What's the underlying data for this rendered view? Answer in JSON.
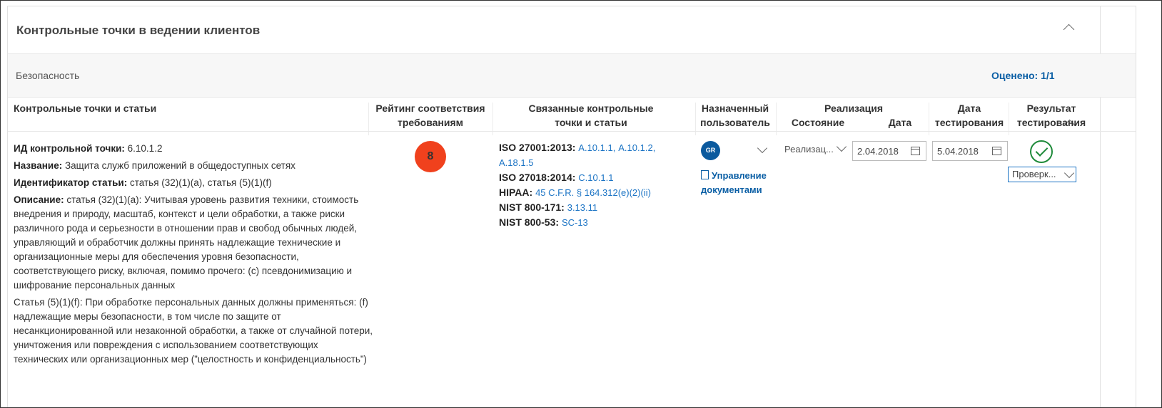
{
  "card": {
    "title": "Контрольные точки в ведении клиентов"
  },
  "section": {
    "label": "Безопасность",
    "assessed": "Оценено: 1/1"
  },
  "table": {
    "headers": {
      "controls": "Контрольные точки и статьи",
      "rating_line1": "Рейтинг соответствия",
      "rating_line2": "требованиям",
      "related_line1": "Связанные контрольные",
      "related_line2": "точки и статьи",
      "assigned_line1": "Назначенный",
      "assigned_line2": "пользователь",
      "implementation": "Реализация",
      "status": "Состояние",
      "date": "Дата",
      "test_date_line1": "Дата",
      "test_date_line2": "тестирования",
      "test_result_line1": "Результат",
      "test_result_line2": "тестирования"
    },
    "row": {
      "control_id_label": "ИД контрольной точки:",
      "control_id": "6.10.1.2",
      "name_label": "Название:",
      "name": "Защита служб приложений в общедоступных сетях",
      "article_id_label": "Идентификатор статьи:",
      "article_id": "статья (32)(1)(a), статья (5)(1)(f)",
      "description_label": "Описание:",
      "description_p1": "статья (32)(1)(a): Учитывая уровень развития техники, стоимость внедрения и природу, масштаб, контекст и цели обработки, а также риски различного рода и серьезности в отношении прав и свобод обычных людей, управляющий и обработчик должны принять надлежащие технические и организационные меры для обеспечения уровня безопасности, соответствующего риску, включая, помимо прочего: (c) псевдонимизацию и шифрование персональных данных",
      "description_p2": "Статья (5)(1)(f): При обработке персональных данных должны применяться: (f) надлежащие меры безопасности, в том числе по защите от несанкционированной или незаконной обработки, а также от случайной потери, уничтожения или повреждения с использованием соответствующих технических или организационных мер (”целостность и конфиденциальность”)",
      "rating": "8",
      "related": [
        {
          "standard": "ISO 27001:2013:",
          "links": [
            "A.10.1.1",
            "A.10.1.2",
            "A.18.1.5"
          ]
        },
        {
          "standard": "ISO 27018:2014:",
          "links": [
            "C.10.1.1"
          ]
        },
        {
          "standard": "HIPAA:",
          "links": [
            "45 C.F.R. § 164.312(e)(2)(ii)"
          ]
        },
        {
          "standard": "NIST 800-171:",
          "links": [
            "3.13.11"
          ]
        },
        {
          "standard": "NIST 800-53:",
          "links": [
            "SC-13"
          ]
        }
      ],
      "assigned_user_initials": "GR",
      "manage_documents_line1": "Управление",
      "manage_documents_line2": "документами",
      "impl_status": "Реализац...",
      "impl_date": "2.04.2018",
      "test_date": "5.04.2018",
      "test_result": "Проверк..."
    }
  },
  "colors": {
    "accent": "#0b5fa5",
    "link": "#1a73c4",
    "rating_bg": "#f0411d",
    "pass": "#1e8a3a"
  }
}
